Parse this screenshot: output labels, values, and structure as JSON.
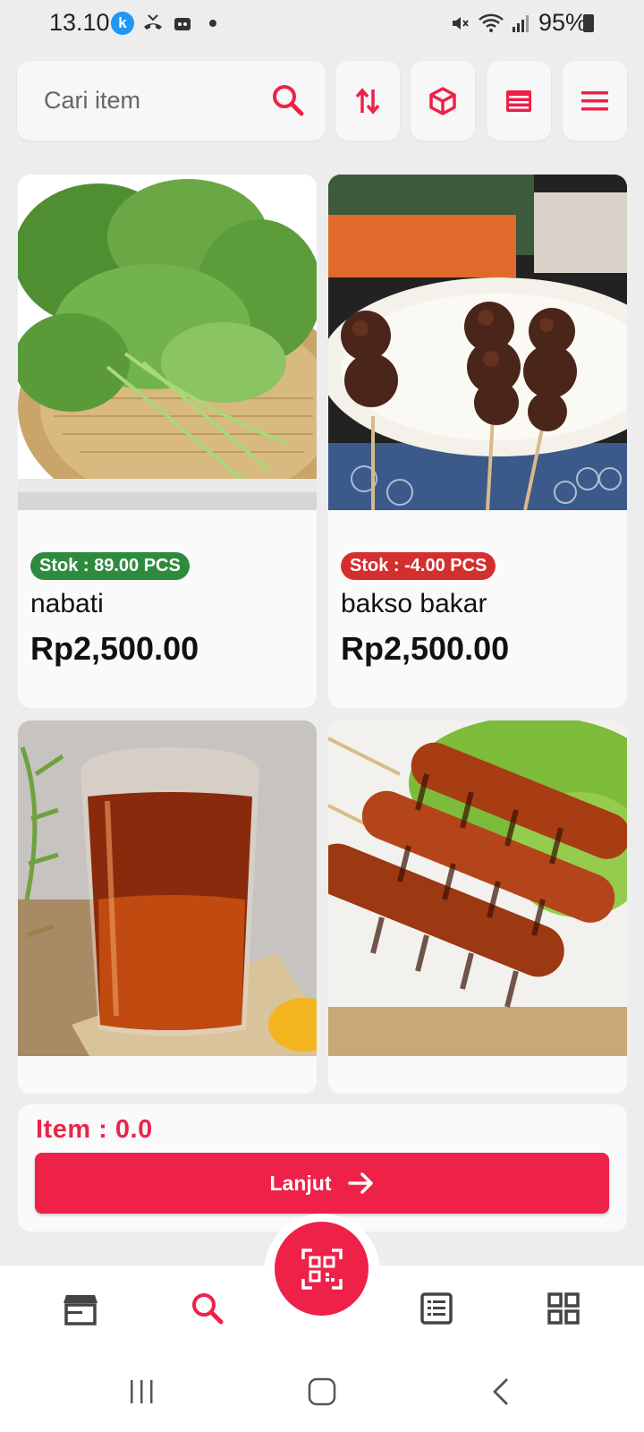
{
  "status_bar": {
    "time": "13.10",
    "k_badge": "k",
    "battery": "95%"
  },
  "search": {
    "placeholder": "Cari item"
  },
  "toolbar_icons": [
    "sort-icon",
    "box-icon",
    "list-view-icon",
    "menu-icon"
  ],
  "products": [
    {
      "stock": "Stok : 89.00 PCS",
      "stock_status": "positive",
      "name": "nabati",
      "price": "Rp2,500.00",
      "image": "leafy-greens"
    },
    {
      "stock": "Stok : -4.00 PCS",
      "stock_status": "negative",
      "name": "bakso bakar",
      "price": "Rp2,500.00",
      "image": "grilled-meatball-skewers"
    },
    {
      "image": "iced-tea-glass"
    },
    {
      "image": "grilled-sausage-skewers"
    }
  ],
  "summary": {
    "item_count": "Item : 0.0",
    "continue_label": "Lanjut"
  },
  "bottom_nav": [
    "store-icon",
    "search-icon",
    "qr-scan-icon",
    "report-list-icon",
    "grid-apps-icon"
  ],
  "colors": {
    "accent": "#ee2149",
    "stock_ok": "#2e8b3e",
    "stock_negative": "#d32f2f"
  }
}
